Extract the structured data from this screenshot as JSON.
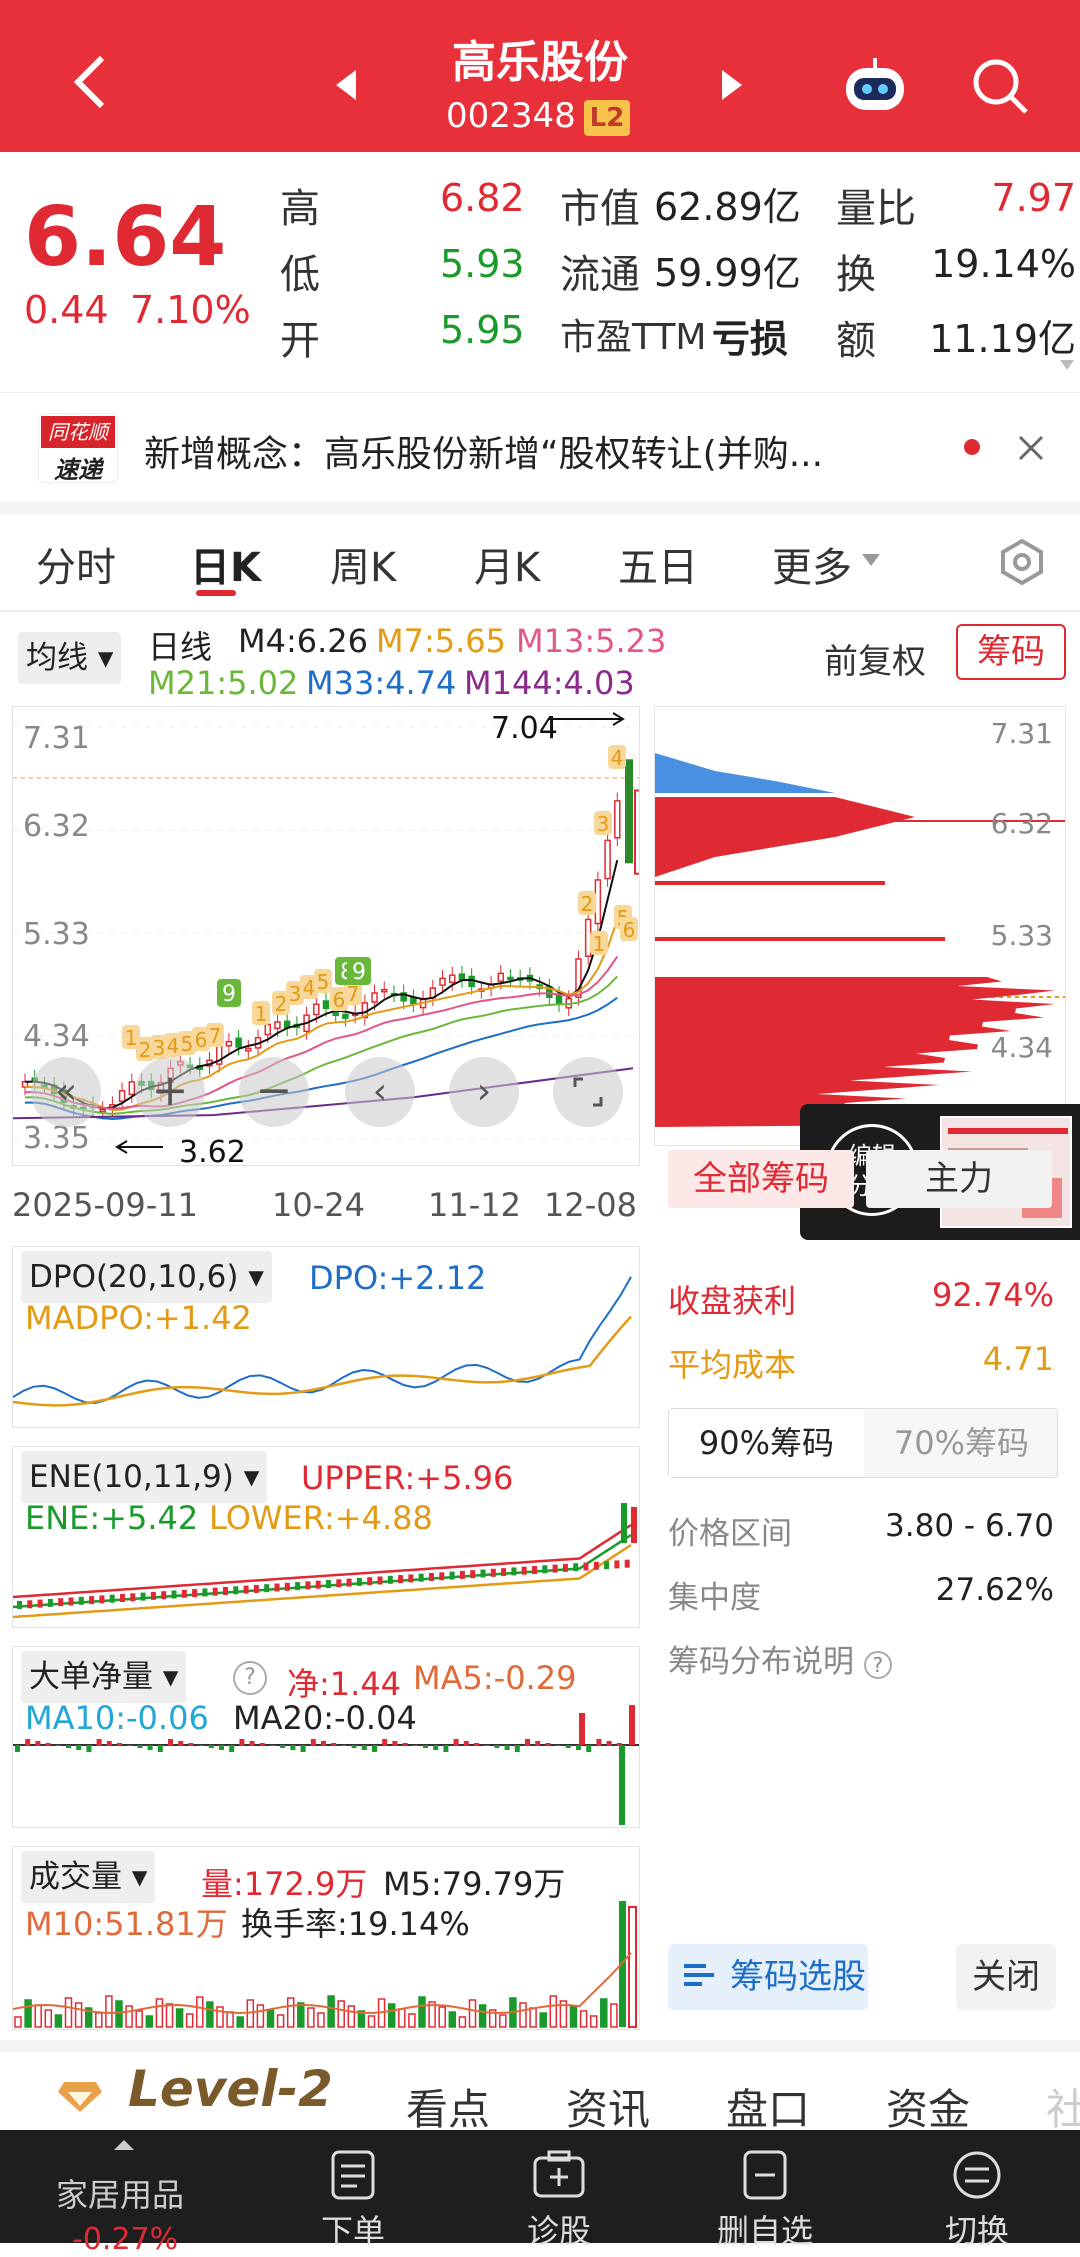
{
  "header": {
    "title": "高乐股份",
    "code": "002348",
    "level_badge": "L2"
  },
  "quote": {
    "price": "6.64",
    "change": "0.44",
    "change_pct": "7.10%",
    "high_label": "高",
    "high": "6.82",
    "low_label": "低",
    "low": "5.93",
    "open_label": "开",
    "open": "5.95",
    "mcap_label": "市值",
    "mcap": "62.89亿",
    "float_label": "流通",
    "float": "59.99亿",
    "pe_label": "市盈TTM",
    "pe": "亏损",
    "vr_label": "量比",
    "vr": "7.97",
    "turnover_label": "换",
    "turnover": "19.14%",
    "amount_label": "额",
    "amount": "11.19亿"
  },
  "news": {
    "logo_top": "同花顺",
    "logo_bottom": "速递",
    "text": "新增概念：高乐股份新增“股权转让(并购..."
  },
  "tabs": [
    "分时",
    "日K",
    "周K",
    "月K",
    "五日",
    "更多"
  ],
  "kchart": {
    "ma_selector": "均线",
    "period": "日线",
    "m4": "M4:6.26",
    "m7": "M7:5.65",
    "m13": "M13:5.23",
    "m21": "M21:5.02",
    "m33": "M33:4.74",
    "m144": "M144:4.03",
    "adjust": "前复权",
    "chips_button": "筹码",
    "y_ticks": [
      "7.31",
      "6.32",
      "5.33",
      "4.34",
      "3.35"
    ],
    "x_ticks": [
      "2025-09-11",
      "10-24",
      "11-12",
      "12-08"
    ],
    "max_label": "7.04",
    "min_label": "3.62"
  },
  "chart_data": {
    "type": "line",
    "x": [
      "2025-09-11",
      "10-24",
      "11-12",
      "12-08"
    ],
    "series": [
      {
        "name": "日K",
        "values": [
          3.62,
          4.5,
          4.9,
          7.04
        ]
      }
    ],
    "ylim": [
      3.35,
      7.31
    ]
  },
  "chips": {
    "y_ticks": [
      "7.31",
      "6.32",
      "5.33",
      "4.34"
    ],
    "share_top": "编辑",
    "share_bottom": "分享",
    "tab_all": "全部筹码",
    "tab_main": "主力",
    "profit_label": "收盘获利",
    "profit": "92.74%",
    "cost_label": "平均成本",
    "cost": "4.71",
    "tab90": "90%筹码",
    "tab70": "70%筹码",
    "range_label": "价格区间",
    "range": "3.80 - 6.70",
    "conc_label": "集中度",
    "conc": "27.62%",
    "explain": "筹码分布说明",
    "select_btn": "筹码选股",
    "close_btn": "关闭"
  },
  "dpo": {
    "name": "DPO(20,10,6)",
    "dpo": "DPO:+2.12",
    "madpo": "MADPO:+1.42"
  },
  "ene": {
    "name": "ENE(10,11,9)",
    "upper": "UPPER:+5.96",
    "ene": "ENE:+5.42",
    "lower": "LOWER:+4.88"
  },
  "bigorder": {
    "name": "大单净量",
    "net": "净:1.44",
    "ma5": "MA5:-0.29",
    "ma10": "MA10:-0.06",
    "ma20": "MA20:-0.04"
  },
  "volume": {
    "name": "成交量",
    "vol": "量:172.9万",
    "m5": "M5:79.79万",
    "m10": "M10:51.81万",
    "turnover": "换手率:19.14%"
  },
  "subtabs": {
    "level2": "Level-2",
    "items": [
      "看点",
      "资讯",
      "盘口",
      "资金",
      "社"
    ]
  },
  "bottom": {
    "sector": "家居用品",
    "sector_pct": "-0.27%",
    "items": [
      "下单",
      "诊股",
      "删自选",
      "切换"
    ]
  }
}
